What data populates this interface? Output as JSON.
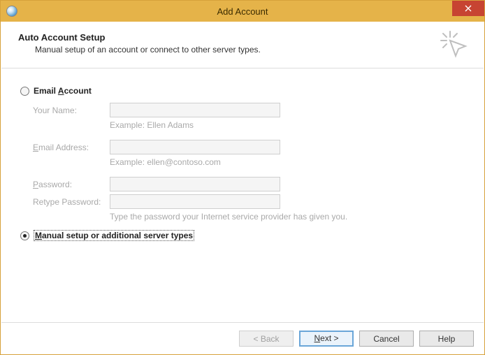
{
  "window": {
    "title": "Add Account"
  },
  "header": {
    "title": "Auto Account Setup",
    "subtitle": "Manual setup of an account or connect to other server types."
  },
  "options": {
    "email_account": {
      "label_pre": "Email ",
      "label_u": "A",
      "label_post": "ccount",
      "selected": false
    },
    "manual_setup": {
      "label_u": "M",
      "label_post": "anual setup or additional server types",
      "selected": true
    }
  },
  "form": {
    "your_name": {
      "label": "Your Name:",
      "value": "",
      "hint": "Example: Ellen Adams"
    },
    "email": {
      "label_pre": "",
      "label_u": "E",
      "label_post": "mail Address:",
      "value": "",
      "hint": "Example: ellen@contoso.com"
    },
    "password": {
      "label_pre": "",
      "label_u": "P",
      "label_post": "assword:",
      "value": ""
    },
    "retype": {
      "label": "Retype Password:",
      "value": ""
    },
    "password_hint": "Type the password your Internet service provider has given you."
  },
  "footer": {
    "back": {
      "label": "< Back",
      "enabled": false
    },
    "next": {
      "label_u": "N",
      "label_post": "ext >",
      "enabled": true
    },
    "cancel": "Cancel",
    "help": "Help"
  }
}
